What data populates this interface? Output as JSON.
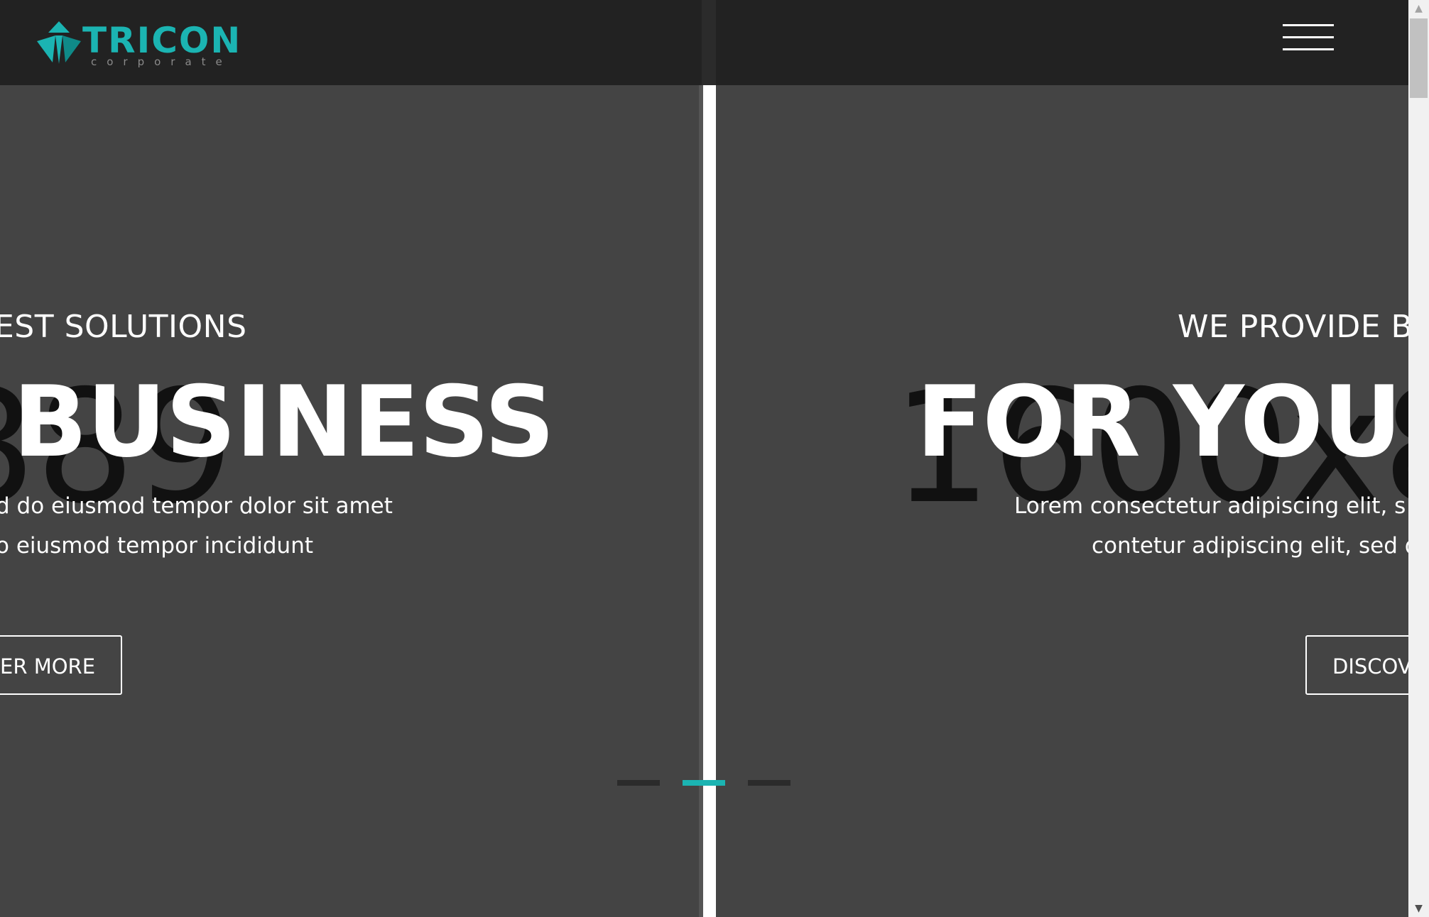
{
  "brand": {
    "name": "TRICON",
    "tagline": "corporate",
    "accent_color": "#1bb4b2"
  },
  "header": {
    "menu_icon": "hamburger-icon"
  },
  "slides": [
    {
      "placeholder": "889",
      "kicker": "EST SOLUTIONS",
      "headline": "BUSINESS",
      "line1": "d do eiusmod tempor dolor sit amet",
      "line2": "o eiusmod tempor incididunt",
      "button": "ER MORE"
    },
    {
      "placeholder": "1600x8",
      "kicker": "WE PROVIDE B",
      "headline": "FOR YOUR",
      "line1": "Lorem consectetur adipiscing elit, s",
      "line2": "contetur adipiscing elit, sed d",
      "button": "DISCOV"
    }
  ],
  "pagination": {
    "count": 3,
    "active_index": 1
  },
  "scrollbar": {
    "up_icon": "scroll-up-arrow-icon",
    "down_icon": "scroll-down-arrow-icon"
  }
}
